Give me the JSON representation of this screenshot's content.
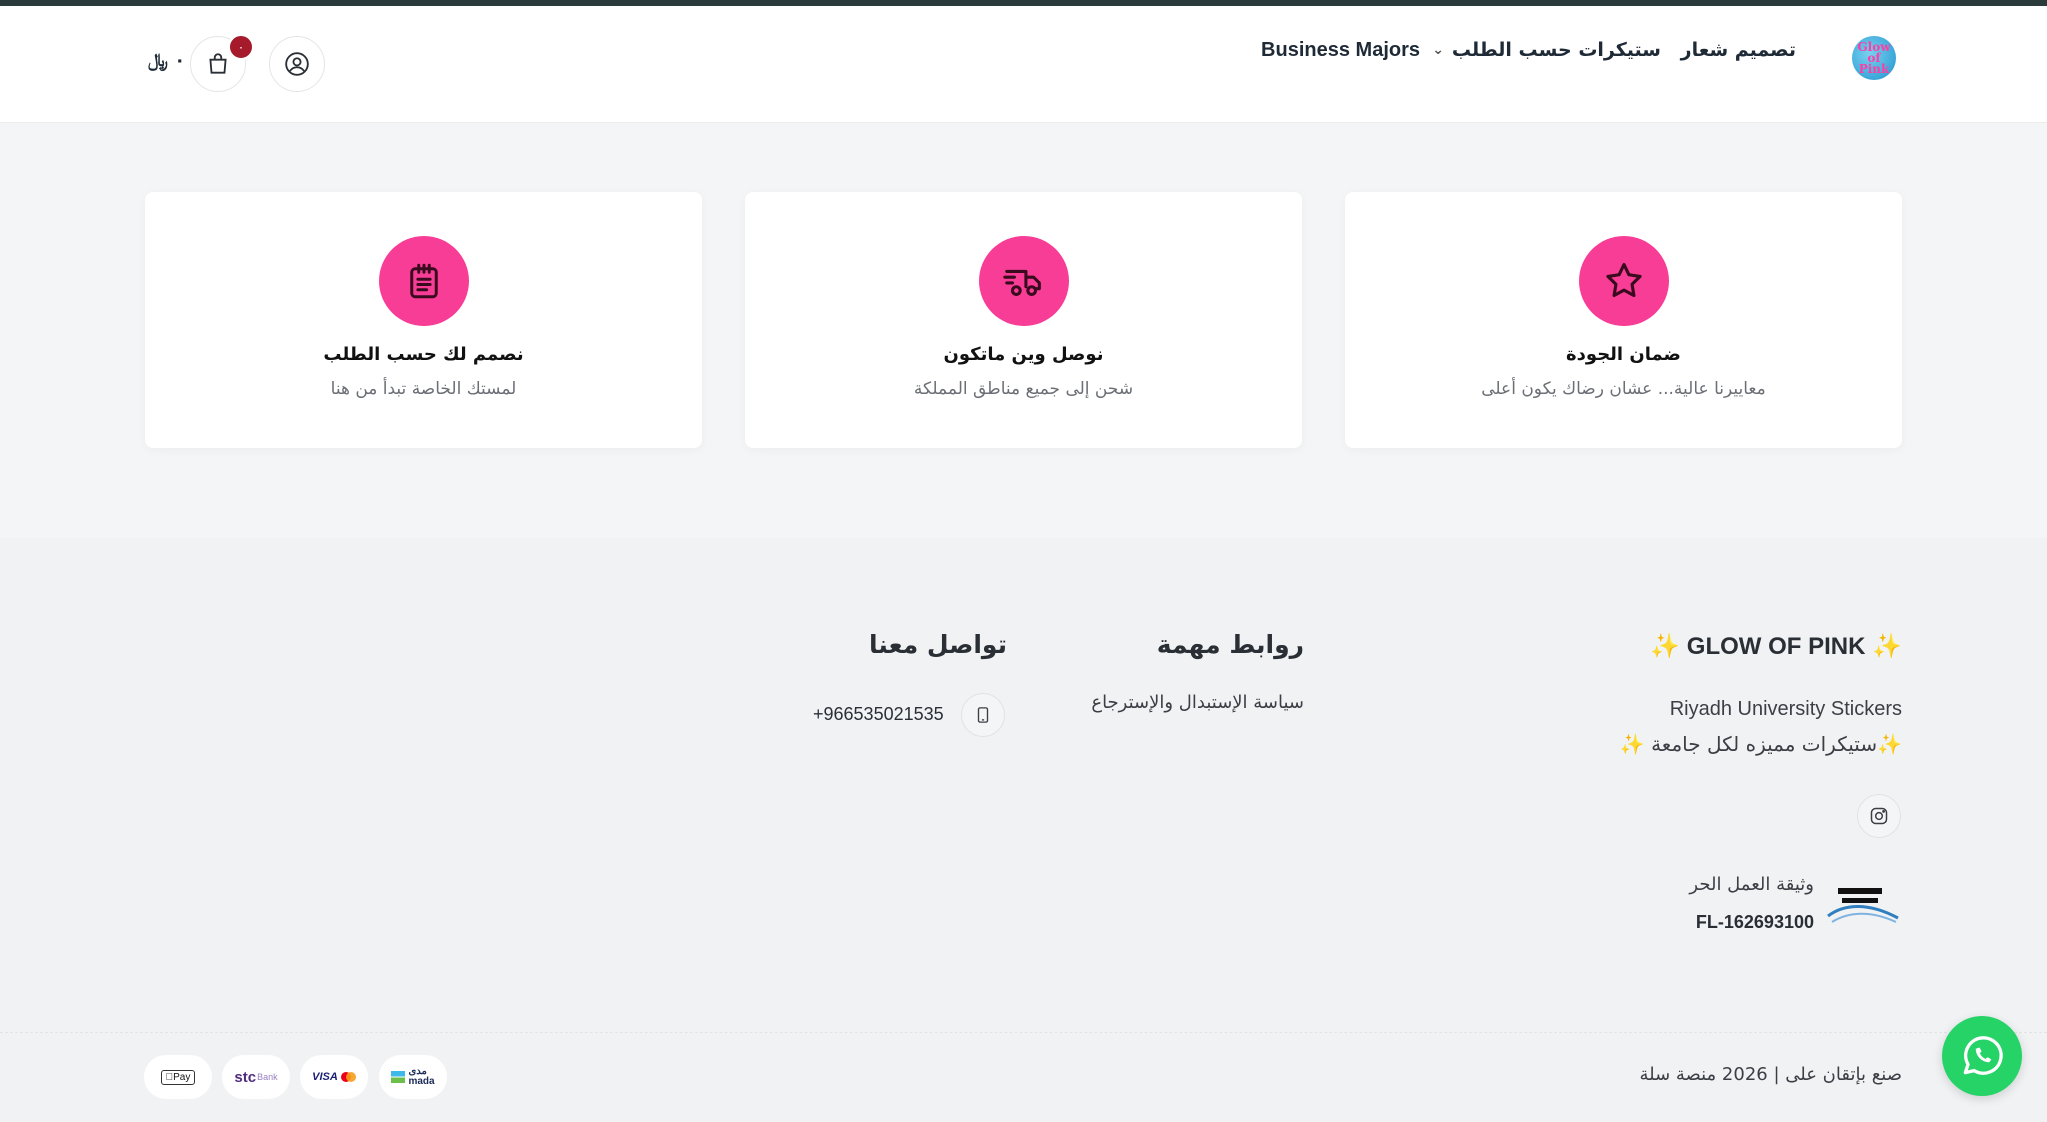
{
  "header": {
    "logo_text": "Glow of Pink",
    "nav": {
      "logo_design": "تصميم شعار",
      "stickers": "ستيكرات حسب الطلب",
      "business": "Business Majors"
    },
    "cart": {
      "badge_count": "٠",
      "total": "٠ ﷼"
    }
  },
  "features": [
    {
      "title": "ضمان الجودة",
      "subtitle": "معاييرنا عالية... عشان رضاك يكون أعلى",
      "icon": "star-icon"
    },
    {
      "title": "نوصل وين ماتكون",
      "subtitle": "شحن إلى جميع مناطق المملكة",
      "icon": "delivery-truck-icon"
    },
    {
      "title": "نصمم لك حسب الطلب",
      "subtitle": "لمستك الخاصة تبدأ من هنا",
      "icon": "notepad-icon"
    }
  ],
  "footer": {
    "brand": {
      "title": "GLOW OF PINK",
      "spark": "✨",
      "line1": "Riyadh University Stickers",
      "line2": "ستيكرات مميزه لكل جامعة"
    },
    "freelance": {
      "label": "وثيقة العمل الحر",
      "number": "FL-162693100"
    },
    "links": {
      "title": "روابط مهمة",
      "items": [
        "سياسة الإستبدال والإسترجاع"
      ]
    },
    "contact": {
      "title": "تواصل معنا",
      "phone": "+966535021535"
    },
    "copyright": "صنع بإتقان على | 2026 منصة سلة",
    "payments": [
      "mada",
      "visa-mastercard",
      "stc-bank",
      "apple-pay"
    ]
  },
  "colors": {
    "accent_pink": "#f73d95",
    "whatsapp_green": "#25d366",
    "badge_red": "#a51b2b"
  }
}
